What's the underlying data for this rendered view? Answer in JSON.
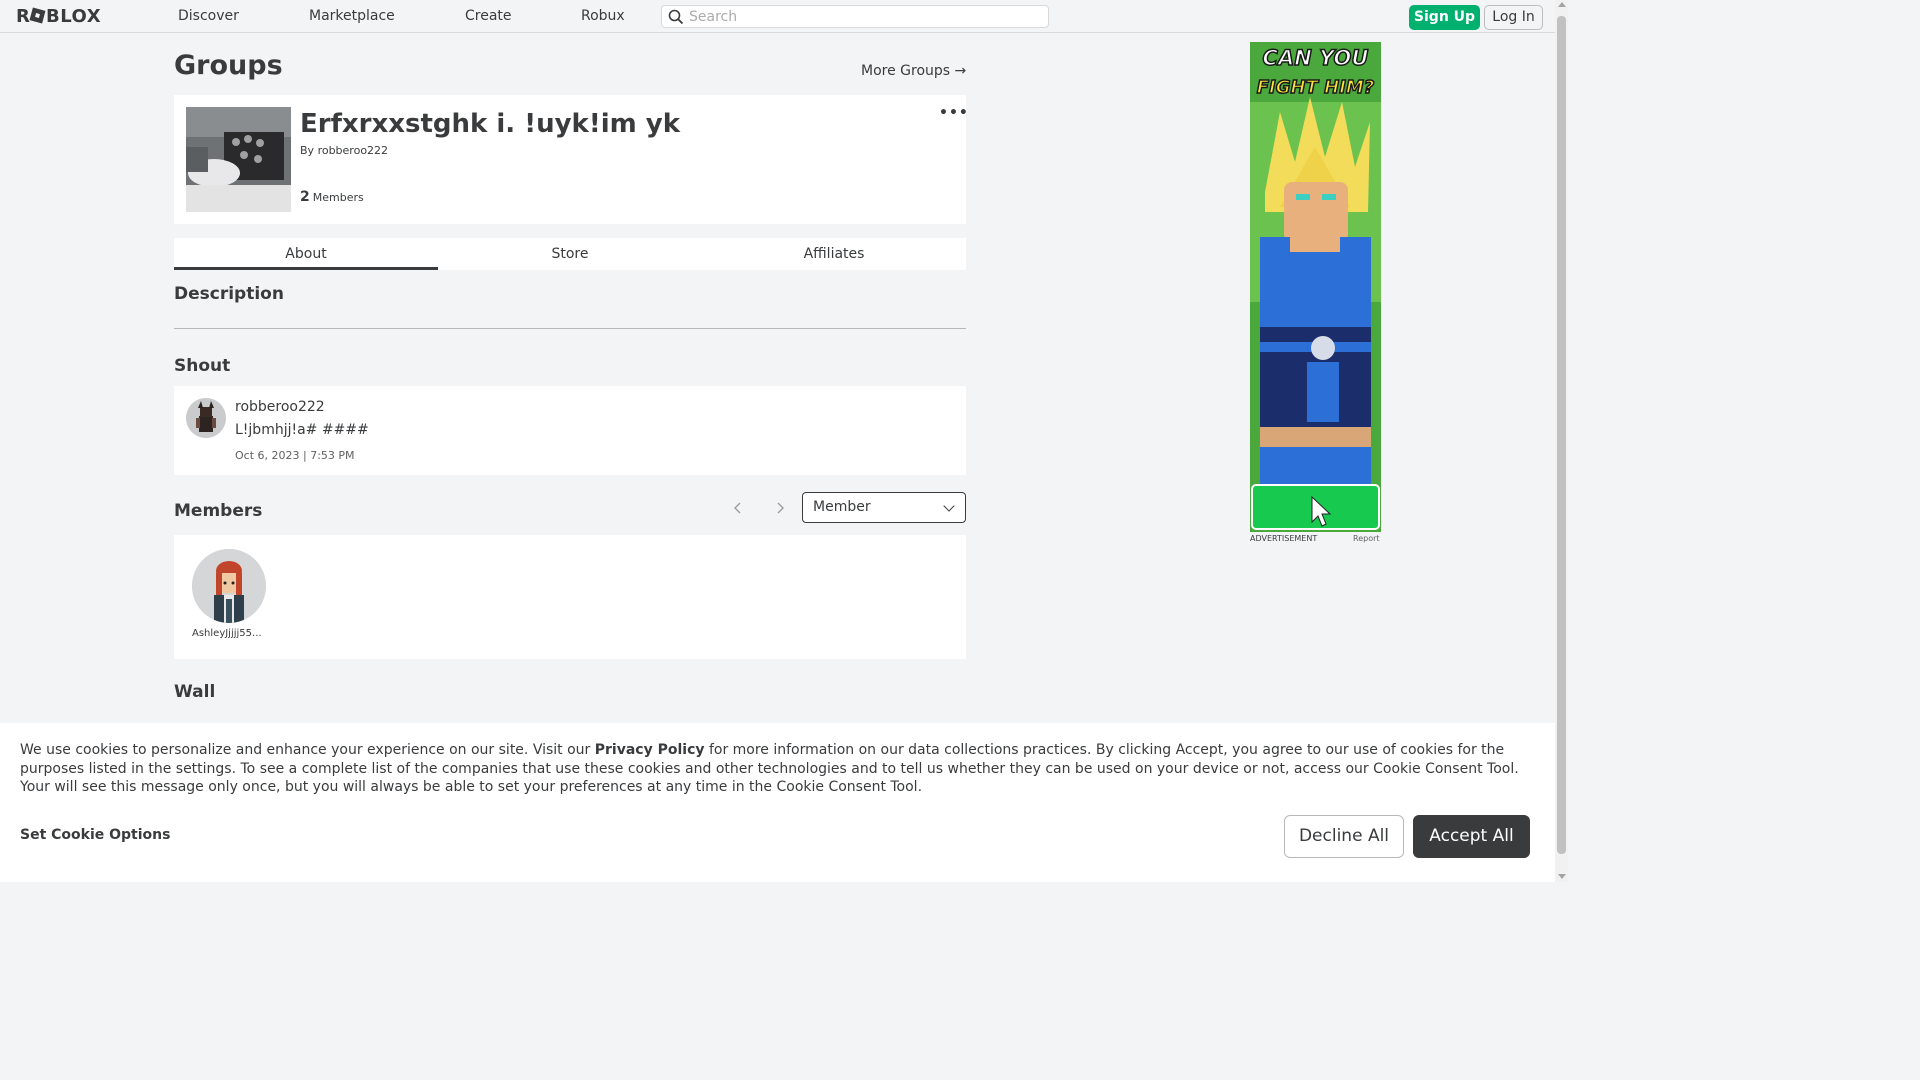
{
  "nav": {
    "logo": "R■BLOX",
    "links": [
      "Discover",
      "Marketplace",
      "Create",
      "Robux"
    ],
    "search_placeholder": "Search",
    "signup_label": "Sign Up",
    "login_label": "Log In"
  },
  "page": {
    "title": "Groups",
    "more_groups": "More Groups →"
  },
  "group": {
    "name": "Erfxrxxstghk i. !uyk!im yk",
    "by_prefix": "By",
    "owner": "robberoo222",
    "member_count": "2",
    "member_label": "Members",
    "more_icon": "•••"
  },
  "tabs": [
    "About",
    "Store",
    "Affiliates"
  ],
  "sections": {
    "description": "Description",
    "shout": "Shout",
    "members": "Members",
    "wall": "Wall"
  },
  "shout": {
    "user": "robberoo222",
    "text": "L!jbmhjj!a# ####",
    "date": "Oct 6, 2023 | 7:53 PM"
  },
  "members": {
    "role_selected": "Member",
    "list": [
      {
        "name": "AshleyJjjjj55..."
      }
    ]
  },
  "ad": {
    "headline_line1": "CAN YOU",
    "headline_line2": "FIGHT HIM?",
    "label": "ADVERTISEMENT",
    "report": "Report"
  },
  "cookie": {
    "text_before": "We use cookies to personalize and enhance your experience on our site. Visit our ",
    "privacy_link": "Privacy Policy",
    "text_after": " for more information on our data collections practices. By clicking Accept, you agree to our use of cookies for the purposes listed in the settings. To see a complete list of the companies that use these cookies and other technologies and to tell us whether they can be used on your device or not, access our Cookie Consent Tool. Your will see this message only once, but you will always be able to set your preferences at any time in the Cookie Consent Tool.",
    "options_label": "Set Cookie Options",
    "decline_label": "Decline All",
    "accept_label": "Accept All"
  },
  "colors": {
    "accent_green": "#00b06f",
    "text_dark": "#393b3d",
    "page_bg": "#f2f4f5"
  }
}
